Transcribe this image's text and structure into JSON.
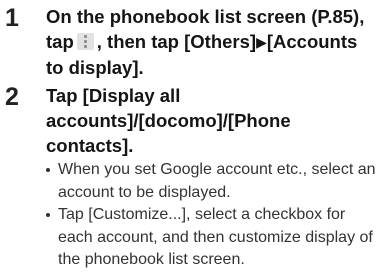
{
  "steps": [
    {
      "number": "1",
      "title_part1": "On the phonebook list screen (P.85), tap",
      "title_part2": ", then tap [Others]",
      "arrow": "▶",
      "title_part3": "[Accounts to display].",
      "icon": "vertical-dots-menu-icon"
    },
    {
      "number": "2",
      "title": "Tap [Display all accounts]/[docomo]/[Phone contacts].",
      "bullets": [
        "When you set Google account etc., select an account to be displayed.",
        "Tap [Customize...], select a checkbox for each account, and then customize display of the phonebook list screen."
      ]
    }
  ]
}
